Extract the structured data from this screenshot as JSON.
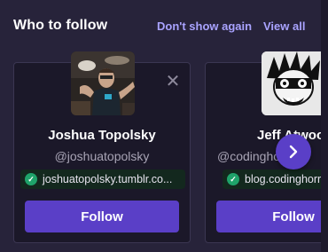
{
  "header": {
    "title": "Who to follow",
    "dont_show_again": "Don't show again",
    "view_all": "View all"
  },
  "cards": [
    {
      "name": "Joshua Topolsky",
      "handle": "@joshuatopolsky",
      "url": "joshuatopolsky.tumblr.co...",
      "follow_label": "Follow"
    },
    {
      "name": "Jeff Atwoo",
      "handle": "@codinghorror",
      "url": "blog.codinghorror",
      "follow_label": "Follow"
    }
  ],
  "icons": {
    "close": "close-icon",
    "verified": "verified-check-icon",
    "next": "chevron-right-icon"
  },
  "colors": {
    "accent": "#5a3fc7",
    "link": "#a9a3ff",
    "verified": "#1fa36a"
  }
}
